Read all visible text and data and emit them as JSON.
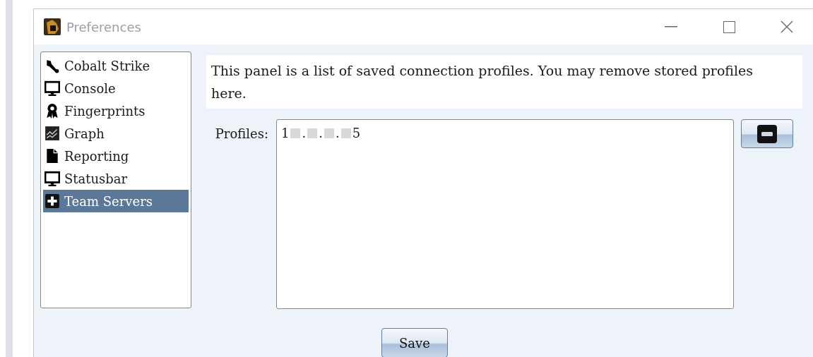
{
  "window": {
    "title": "Preferences"
  },
  "sidebar": {
    "items": [
      {
        "label": "Cobalt Strike",
        "kind": "wrench",
        "selected": false
      },
      {
        "label": "Console",
        "kind": "monitor",
        "selected": false
      },
      {
        "label": "Fingerprints",
        "kind": "award",
        "selected": false
      },
      {
        "label": "Graph",
        "kind": "chart",
        "selected": false
      },
      {
        "label": "Reporting",
        "kind": "document",
        "selected": false
      },
      {
        "label": "Statusbar",
        "kind": "monitor",
        "selected": false
      },
      {
        "label": "Team Servers",
        "kind": "plus",
        "selected": true
      }
    ]
  },
  "description": "This panel is a list of saved connection profiles. You may remove stored profiles here.",
  "profiles": {
    "label": "Profiles:",
    "items": [
      {
        "visible_parts": [
          "1",
          ".",
          ".",
          ".",
          "5"
        ],
        "selected": false
      }
    ]
  },
  "buttons": {
    "save": "Save"
  }
}
